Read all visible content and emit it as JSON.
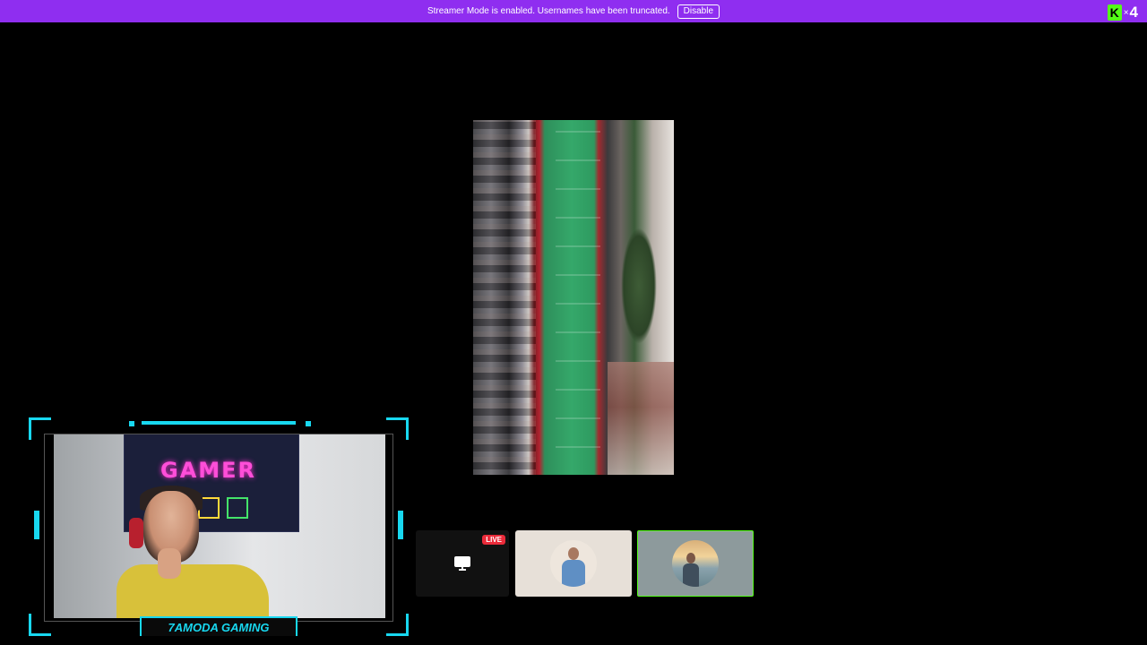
{
  "banner": {
    "message": "Streamer Mode is enabled. Usernames have been truncated.",
    "disable_label": "Disable",
    "background_color": "#8f2ef0"
  },
  "logo": {
    "letter": "K",
    "times": "×",
    "count": "4",
    "brand_color": "#53fc18"
  },
  "main_video": {
    "icon": "shared-screen-video"
  },
  "webcam": {
    "overlay_label": "7AMODA GAMING",
    "poster_text": "GAMER",
    "frame_color": "#18d8f0"
  },
  "participants": [
    {
      "kind": "screen-share",
      "icon": "monitor-icon",
      "badge": "LIVE"
    },
    {
      "kind": "camera-off",
      "icon": "avatar"
    },
    {
      "kind": "camera-off",
      "icon": "avatar",
      "active": true
    }
  ],
  "colors": {
    "live_badge": "#ea2b3a",
    "active_border": "#53fc18"
  }
}
